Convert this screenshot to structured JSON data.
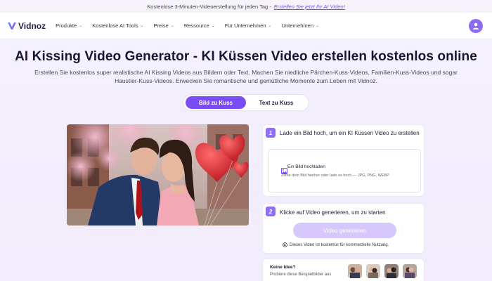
{
  "promo": {
    "text": "Kostenlose 3-Minuten-Videoerstellung für jeden Tag -",
    "link": "Erstellen Sie jetzt Ihr AI Video!"
  },
  "nav": {
    "logo": "Vidnoz",
    "items": [
      {
        "label": "Produkte"
      },
      {
        "label": "Kostenlose AI Tools"
      },
      {
        "label": "Preise"
      },
      {
        "label": "Ressource"
      },
      {
        "label": "Für Unternehmen"
      },
      {
        "label": "Unternehmen"
      }
    ],
    "chevron": "⌄"
  },
  "page": {
    "title": "AI Kissing Video Generator - KI Küssen Video erstellen kostenlos online",
    "subtitle": "Erstellen Sie kostenlos super realistische AI Kissing Videos aus Bildern oder Text. Machen Sie niedliche Pärchen-Kuss-Videos, Familien-Kuss-Videos und sogar Haustier-Kuss-Videos. Erwecken Sie romantische und gemütliche Momente zum Leben mit Vidnoz."
  },
  "tabs": {
    "active": "Bild zu Kuss",
    "inactive": "Text zu Kuss"
  },
  "step1": {
    "number": "1",
    "title": "Lade ein Bild hoch, um ein KI Küssen Video zu erstellen",
    "upload_title": "Ein Bild hochladen",
    "upload_hint": "Ziehe dein Bild hierher oder lade es hoch — JPG, PNG, WEBP"
  },
  "step2": {
    "number": "2",
    "title": "Klicke auf Video generieren, um zu starten",
    "button": "Video generieren",
    "note": "Dieses Video ist kostenlos für kommerzielle Nutzung."
  },
  "ideas": {
    "title": "Keine Idee?",
    "text": "Probiere diese Beispielbilder aus"
  },
  "colors": {
    "accent": "#7a4cf5",
    "button_disabled": "#d6c8fb",
    "step_badge": "#8f6df5"
  }
}
